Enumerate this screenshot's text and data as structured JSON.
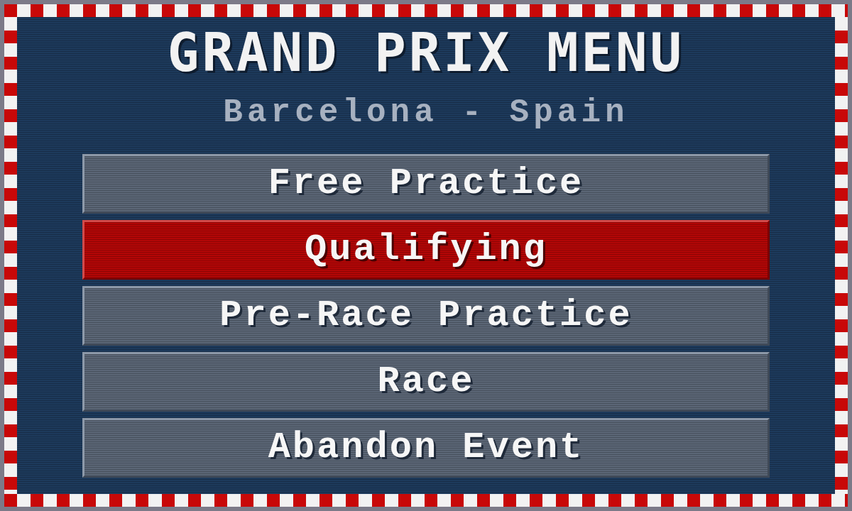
{
  "title": "GRAND PRIX MENU",
  "subtitle": "Barcelona - Spain",
  "menu": [
    {
      "label": "Free Practice",
      "selected": false
    },
    {
      "label": "Qualifying",
      "selected": true
    },
    {
      "label": "Pre-Race Practice",
      "selected": false
    },
    {
      "label": "Race",
      "selected": false
    },
    {
      "label": "Abandon Event",
      "selected": false
    }
  ]
}
